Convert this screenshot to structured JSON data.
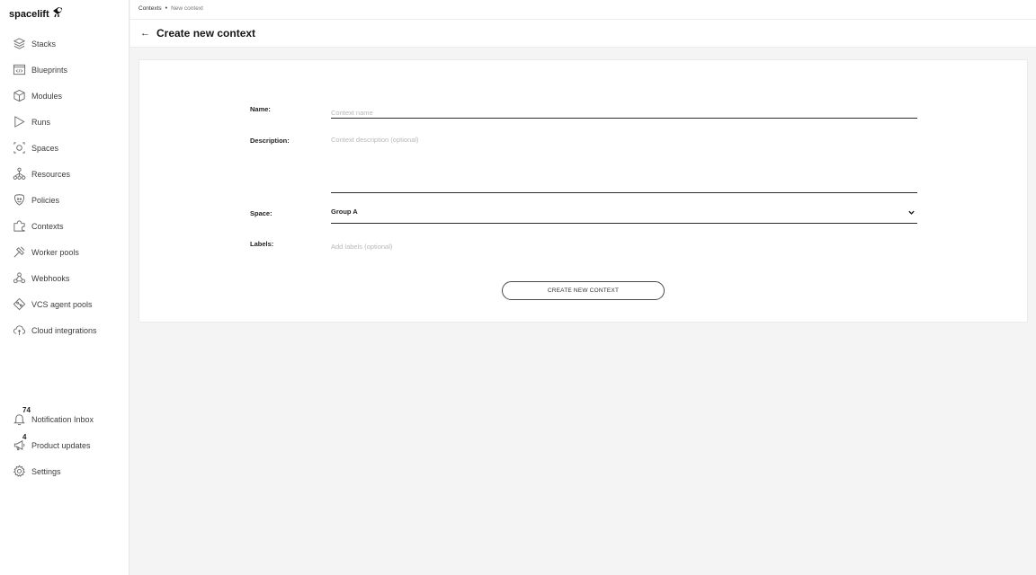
{
  "app": {
    "logo_text": "spacelift"
  },
  "sidebar": {
    "items": [
      {
        "label": "Stacks",
        "icon": "stacks-icon"
      },
      {
        "label": "Blueprints",
        "icon": "blueprints-icon"
      },
      {
        "label": "Modules",
        "icon": "modules-icon"
      },
      {
        "label": "Runs",
        "icon": "runs-icon"
      },
      {
        "label": "Spaces",
        "icon": "spaces-icon"
      },
      {
        "label": "Resources",
        "icon": "resources-icon"
      },
      {
        "label": "Policies",
        "icon": "policies-icon"
      },
      {
        "label": "Contexts",
        "icon": "contexts-icon"
      },
      {
        "label": "Worker pools",
        "icon": "worker-pools-icon"
      },
      {
        "label": "Webhooks",
        "icon": "webhooks-icon"
      },
      {
        "label": "VCS agent pools",
        "icon": "vcs-agent-pools-icon"
      },
      {
        "label": "Cloud integrations",
        "icon": "cloud-integrations-icon"
      }
    ],
    "bottom": [
      {
        "label": "Notification Inbox",
        "badge": "74",
        "icon": "bell-icon"
      },
      {
        "label": "Product updates",
        "badge": "4",
        "icon": "megaphone-icon"
      },
      {
        "label": "Settings",
        "icon": "gear-icon"
      }
    ]
  },
  "breadcrumb": {
    "parent": "Contexts",
    "separator": "•",
    "current": "New context"
  },
  "header": {
    "title": "Create new context",
    "back_icon": "←"
  },
  "form": {
    "name_label": "Name:",
    "name_placeholder": "Context name",
    "name_value": "",
    "description_label": "Description:",
    "description_placeholder": "Context description (optional)",
    "description_value": "",
    "space_label": "Space:",
    "space_value": "Group A",
    "labels_label": "Labels:",
    "labels_placeholder": "Add labels (optional)",
    "submit_label": "CREATE NEW CONTEXT"
  },
  "colors": {
    "background": "#f4f4f4",
    "surface": "#ffffff",
    "text": "#1f1f1f",
    "muted": "#b3b3b3"
  }
}
